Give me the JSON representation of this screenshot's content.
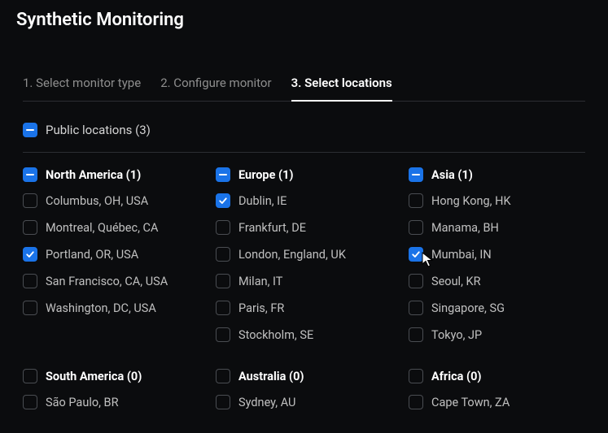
{
  "page_title": "Synthetic Monitoring",
  "steps": [
    {
      "label": "1. Select monitor type",
      "active": false
    },
    {
      "label": "2. Configure monitor",
      "active": false
    },
    {
      "label": "3. Select locations",
      "active": true
    }
  ],
  "public_locations": {
    "label": "Public locations",
    "count": 3,
    "state": "indeterminate"
  },
  "regions_row1": [
    {
      "name": "North America",
      "count": 1,
      "state": "indeterminate",
      "locations": [
        {
          "label": "Columbus, OH, USA",
          "checked": false
        },
        {
          "label": "Montreal, Québec, CA",
          "checked": false
        },
        {
          "label": "Portland, OR, USA",
          "checked": true
        },
        {
          "label": "San Francisco, CA, USA",
          "checked": false
        },
        {
          "label": "Washington, DC, USA",
          "checked": false
        }
      ]
    },
    {
      "name": "Europe",
      "count": 1,
      "state": "indeterminate",
      "locations": [
        {
          "label": "Dublin, IE",
          "checked": true
        },
        {
          "label": "Frankfurt, DE",
          "checked": false
        },
        {
          "label": "London, England, UK",
          "checked": false
        },
        {
          "label": "Milan, IT",
          "checked": false
        },
        {
          "label": "Paris, FR",
          "checked": false
        },
        {
          "label": "Stockholm, SE",
          "checked": false
        }
      ]
    },
    {
      "name": "Asia",
      "count": 1,
      "state": "indeterminate",
      "locations": [
        {
          "label": "Hong Kong, HK",
          "checked": false
        },
        {
          "label": "Manama, BH",
          "checked": false
        },
        {
          "label": "Mumbai, IN",
          "checked": true,
          "cursor": true
        },
        {
          "label": "Seoul, KR",
          "checked": false
        },
        {
          "label": "Singapore, SG",
          "checked": false
        },
        {
          "label": "Tokyo, JP",
          "checked": false
        }
      ]
    }
  ],
  "regions_row2": [
    {
      "name": "South America",
      "count": 0,
      "state": "unchecked",
      "locations": [
        {
          "label": "São Paulo, BR",
          "checked": false
        }
      ]
    },
    {
      "name": "Australia",
      "count": 0,
      "state": "unchecked",
      "locations": [
        {
          "label": "Sydney, AU",
          "checked": false
        }
      ]
    },
    {
      "name": "Africa",
      "count": 0,
      "state": "unchecked",
      "locations": [
        {
          "label": "Cape Town, ZA",
          "checked": false
        }
      ]
    }
  ]
}
